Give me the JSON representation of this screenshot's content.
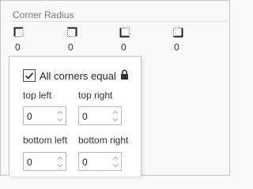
{
  "section_title": "Corner Radius",
  "corners": [
    {
      "name": "top-left-corner-icon",
      "value": "0"
    },
    {
      "name": "top-right-corner-icon",
      "value": "0"
    },
    {
      "name": "bottom-left-corner-icon",
      "value": "0"
    },
    {
      "name": "bottom-right-corner-icon",
      "value": "0"
    }
  ],
  "popup": {
    "all_corners_label": "All corners equal",
    "all_corners_checked": true,
    "lock_icon": "lock-icon",
    "fields": {
      "top_left": {
        "label": "top left",
        "value": "0"
      },
      "top_right": {
        "label": "top right",
        "value": "0"
      },
      "bottom_left": {
        "label": "bottom left",
        "value": "0"
      },
      "bottom_right": {
        "label": "bottom right",
        "value": "0"
      }
    }
  }
}
